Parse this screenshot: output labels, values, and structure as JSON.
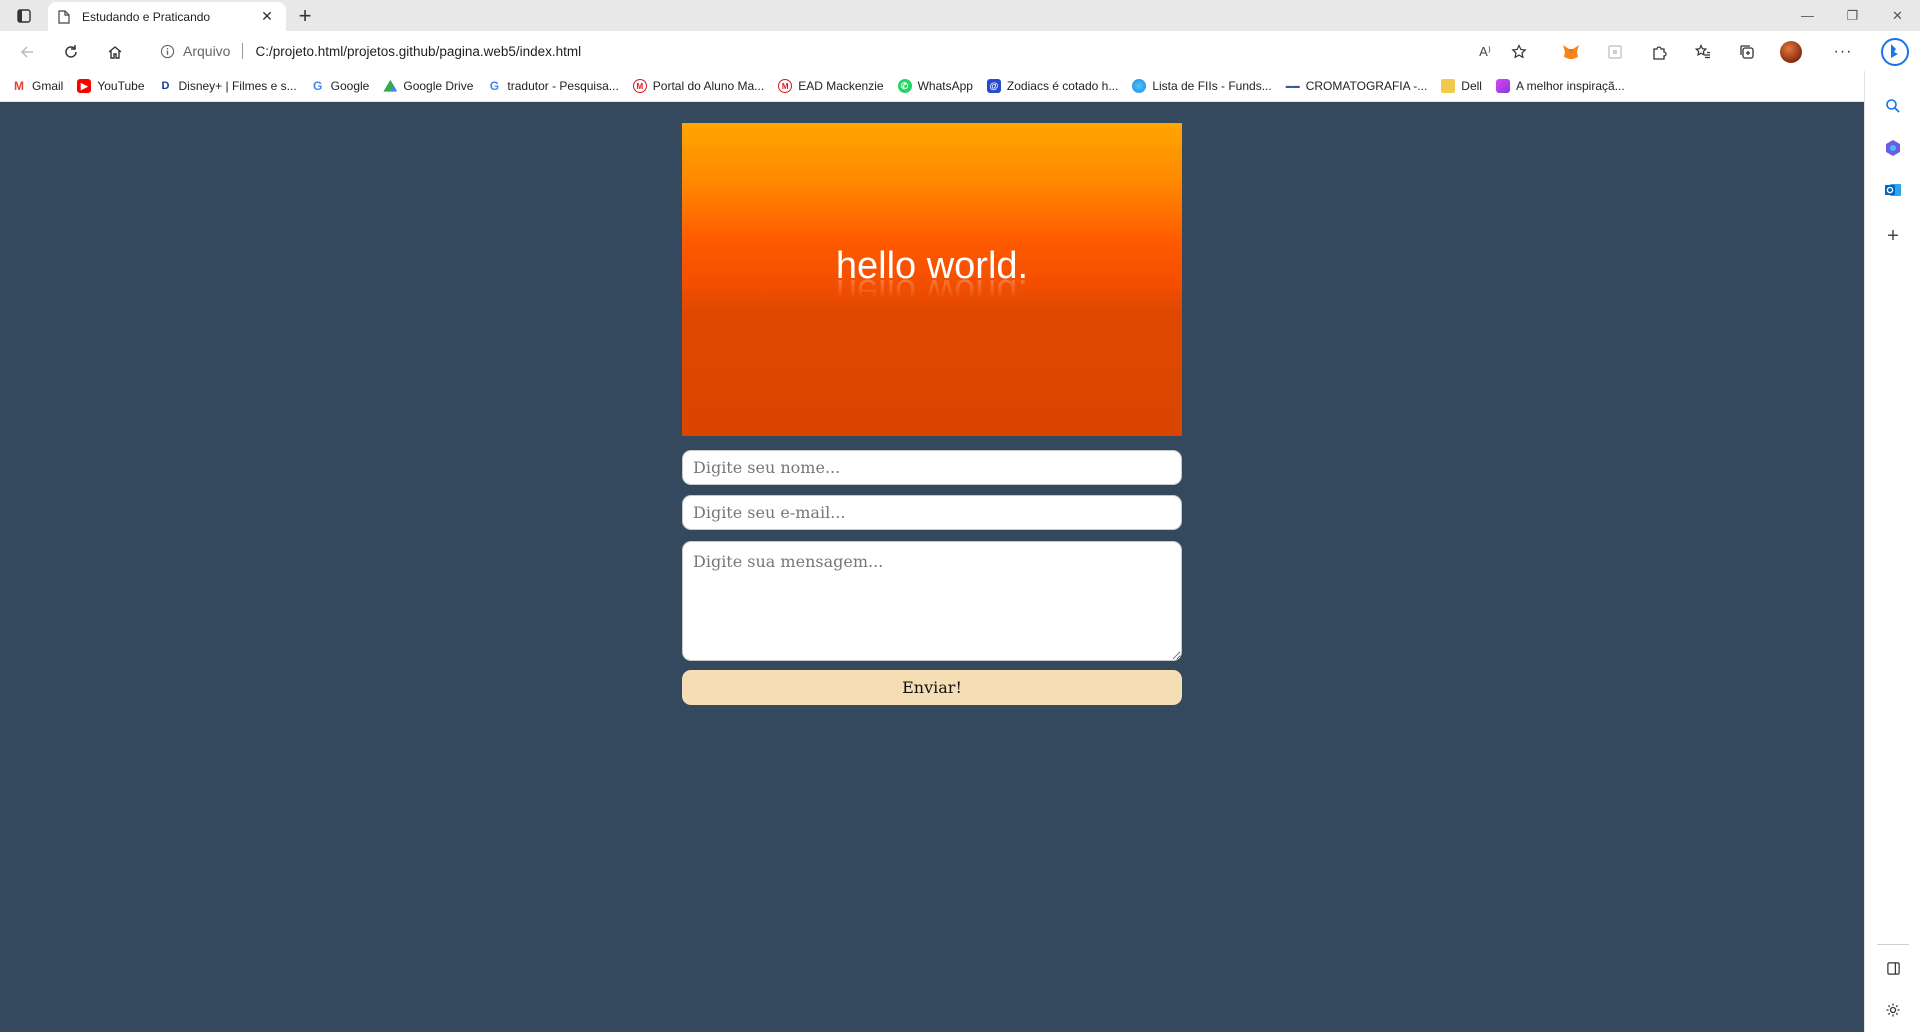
{
  "browser": {
    "tab_title": "Estudando e Praticando",
    "address_info_label": "Arquivo",
    "url": "C:/projeto.html/projetos.github/pagina.web5/index.html",
    "bookmarks": [
      {
        "label": "Gmail",
        "icon": "gmail-icon",
        "color": "#ea4335"
      },
      {
        "label": "YouTube",
        "icon": "youtube-icon",
        "color": "#ff0000"
      },
      {
        "label": "Disney+ | Filmes e s...",
        "icon": "disney-icon",
        "color": "#1a3a8f"
      },
      {
        "label": "Google",
        "icon": "google-icon",
        "color": "#4285f4"
      },
      {
        "label": "Google Drive",
        "icon": "google-drive-icon",
        "color": "#34a853"
      },
      {
        "label": "tradutor - Pesquisa...",
        "icon": "google-icon",
        "color": "#4285f4"
      },
      {
        "label": "Portal do Aluno Ma...",
        "icon": "mackenzie-icon",
        "color": "#d71920"
      },
      {
        "label": "EAD Mackenzie",
        "icon": "mackenzie-icon",
        "color": "#d71920"
      },
      {
        "label": "WhatsApp",
        "icon": "whatsapp-icon",
        "color": "#25d366"
      },
      {
        "label": "Zodiacs é cotado h...",
        "icon": "zodiacs-icon",
        "color": "#2b4acb"
      },
      {
        "label": "Lista de FIIs - Funds...",
        "icon": "funds-icon",
        "color": "#1e88e5"
      },
      {
        "label": "CROMATOGRAFIA -...",
        "icon": "cromatografia-icon",
        "color": "#3b5998"
      },
      {
        "label": "Dell",
        "icon": "folder-icon",
        "color": "#f2c94c"
      },
      {
        "label": "A melhor inspiraçã...",
        "icon": "inspiration-icon",
        "color": "#7e3fd0"
      }
    ]
  },
  "page": {
    "hero_title": "hello world.",
    "form": {
      "name_placeholder": "Digite seu nome...",
      "email_placeholder": "Digite seu e-mail...",
      "message_placeholder": "Digite sua mensagem...",
      "submit_label": "Enviar!"
    },
    "colors": {
      "background": "#34495e",
      "hero_top": "#ffa500",
      "hero_bottom": "#d94600",
      "button": "#f5deb3"
    }
  }
}
